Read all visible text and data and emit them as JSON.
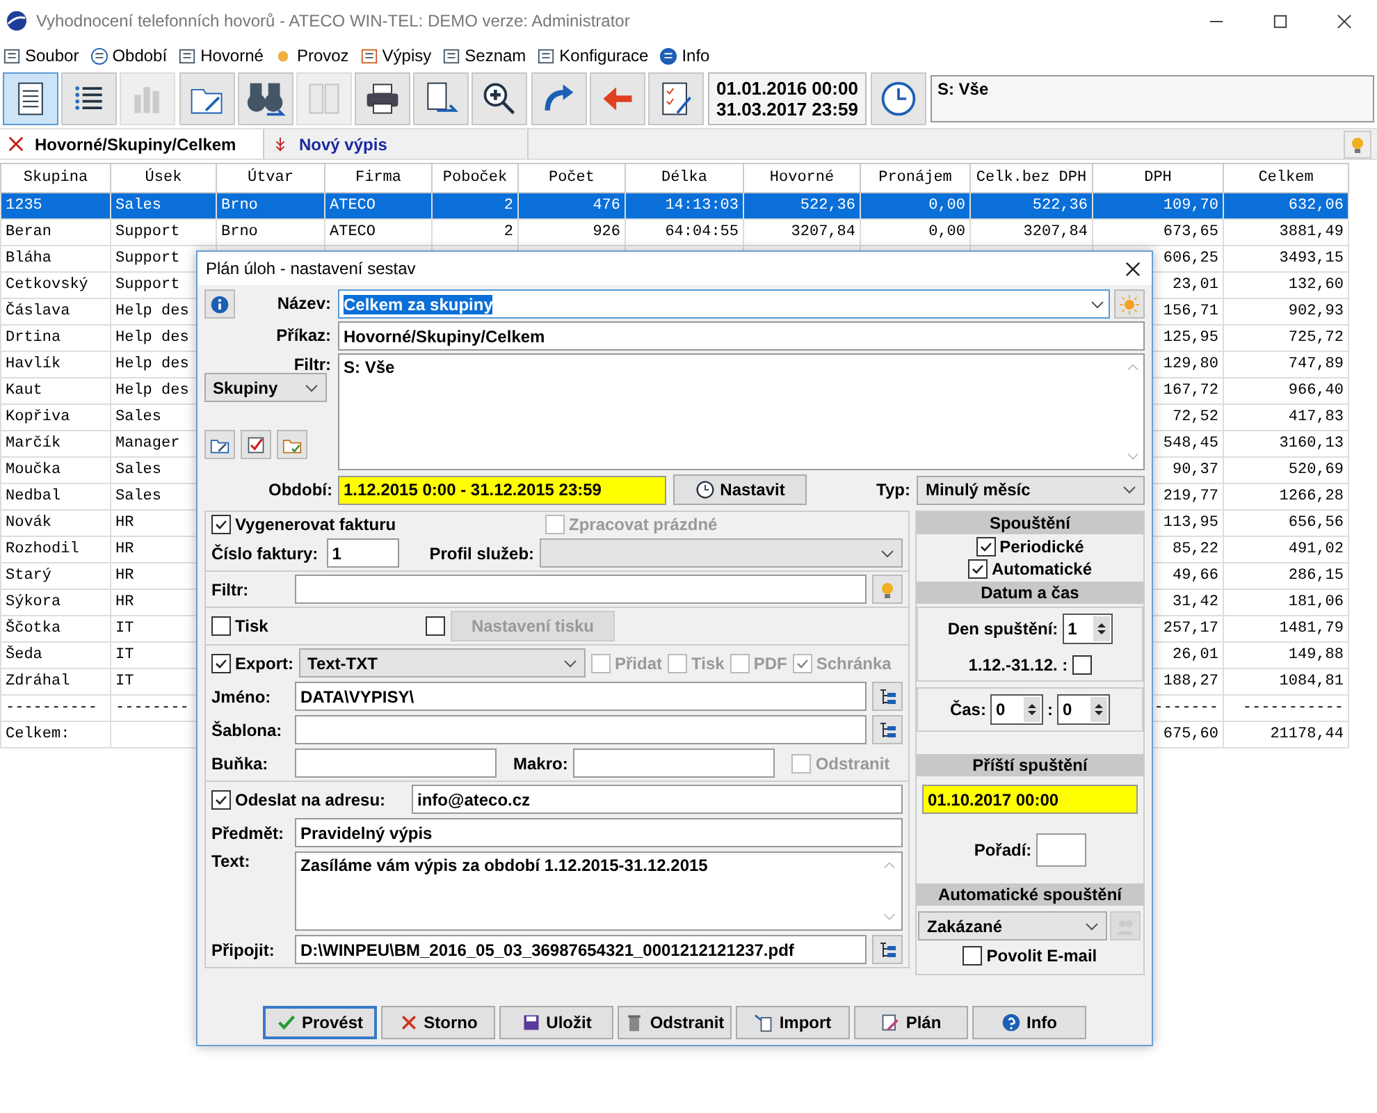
{
  "window": {
    "title": "Vyhodnocení telefonních hovorů - ATECO WIN-TEL: DEMO verze: Administrator"
  },
  "menu": [
    {
      "label": "Soubor"
    },
    {
      "label": "Období"
    },
    {
      "label": "Hovorné"
    },
    {
      "label": "Provoz"
    },
    {
      "label": "Výpisy"
    },
    {
      "label": "Seznam"
    },
    {
      "label": "Konfigurace"
    },
    {
      "label": "Info"
    }
  ],
  "toolbar": {
    "buttons": [
      {
        "selected": true,
        "disabled": false
      },
      {
        "selected": false,
        "disabled": false
      },
      {
        "selected": false,
        "disabled": true
      },
      {
        "selected": false,
        "disabled": false
      },
      {
        "selected": false,
        "disabled": false
      },
      {
        "selected": false,
        "disabled": true
      },
      {
        "selected": false,
        "disabled": false
      },
      {
        "selected": false,
        "disabled": false
      },
      {
        "selected": false,
        "disabled": false
      },
      {
        "selected": false,
        "disabled": false
      },
      {
        "selected": false,
        "disabled": false
      },
      {
        "selected": false,
        "disabled": false
      }
    ],
    "period_from": "01.01.2016 00:00",
    "period_to": "31.03.2017 23:59",
    "filter": "S: Vše"
  },
  "tabs": [
    {
      "label": "Hovorné/Skupiny/Celkem",
      "selected": true
    },
    {
      "label": "Nový výpis",
      "selected": false
    }
  ],
  "table": {
    "columns": [
      "Skupina",
      "Úsek",
      "Útvar",
      "Firma",
      "Poboček",
      "Počet",
      "Délka",
      "Hovorné",
      "Pronájem",
      "Celk.bez DPH",
      "DPH",
      "Celkem"
    ],
    "rows": [
      {
        "selected": true,
        "cells": [
          "1235",
          "Sales",
          "Brno",
          "ATECO",
          "2",
          "476",
          "14:13:03",
          "522,36",
          "0,00",
          "522,36",
          "109,70",
          "632,06"
        ]
      },
      {
        "selected": false,
        "cells": [
          "Beran",
          "Support",
          "Brno",
          "ATECO",
          "2",
          "926",
          "64:04:55",
          "3207,84",
          "0,00",
          "3207,84",
          "673,65",
          "3881,49"
        ]
      },
      {
        "selected": false,
        "cells": [
          "Bláha",
          "Support",
          null,
          null,
          null,
          null,
          null,
          null,
          null,
          null,
          "606,25",
          "3493,15"
        ]
      },
      {
        "selected": false,
        "cells": [
          "Cetkovský",
          "Support",
          null,
          null,
          null,
          null,
          null,
          null,
          null,
          null,
          "23,01",
          "132,60"
        ]
      },
      {
        "selected": false,
        "cells": [
          "Čáslava",
          "Help des",
          null,
          null,
          null,
          null,
          null,
          null,
          null,
          null,
          "156,71",
          "902,93"
        ]
      },
      {
        "selected": false,
        "cells": [
          "Drtina",
          "Help des",
          null,
          null,
          null,
          null,
          null,
          null,
          null,
          null,
          "125,95",
          "725,72"
        ]
      },
      {
        "selected": false,
        "cells": [
          "Havlík",
          "Help des",
          null,
          null,
          null,
          null,
          null,
          null,
          null,
          null,
          "129,80",
          "747,89"
        ]
      },
      {
        "selected": false,
        "cells": [
          "Kaut",
          "Help des",
          null,
          null,
          null,
          null,
          null,
          null,
          null,
          null,
          "167,72",
          "966,40"
        ]
      },
      {
        "selected": false,
        "cells": [
          "Kopřiva",
          "Sales",
          null,
          null,
          null,
          null,
          null,
          null,
          null,
          null,
          "72,52",
          "417,83"
        ]
      },
      {
        "selected": false,
        "cells": [
          "Marčík",
          "Manager",
          null,
          null,
          null,
          null,
          null,
          null,
          null,
          null,
          "548,45",
          "3160,13"
        ]
      },
      {
        "selected": false,
        "cells": [
          "Moučka",
          "Sales",
          null,
          null,
          null,
          null,
          null,
          null,
          null,
          null,
          "90,37",
          "520,69"
        ]
      },
      {
        "selected": false,
        "cells": [
          "Nedbal",
          "Sales",
          null,
          null,
          null,
          null,
          null,
          null,
          null,
          null,
          "219,77",
          "1266,28"
        ]
      },
      {
        "selected": false,
        "cells": [
          "Novák",
          "HR",
          null,
          null,
          null,
          null,
          null,
          null,
          null,
          null,
          "113,95",
          "656,56"
        ]
      },
      {
        "selected": false,
        "cells": [
          "Rozhodil",
          "HR",
          null,
          null,
          null,
          null,
          null,
          null,
          null,
          null,
          "85,22",
          "491,02"
        ]
      },
      {
        "selected": false,
        "cells": [
          "Starý",
          "HR",
          null,
          null,
          null,
          null,
          null,
          null,
          null,
          null,
          "49,66",
          "286,15"
        ]
      },
      {
        "selected": false,
        "cells": [
          "Sýkora",
          "HR",
          null,
          null,
          null,
          null,
          null,
          null,
          null,
          null,
          "31,42",
          "181,06"
        ]
      },
      {
        "selected": false,
        "cells": [
          "Ščotka",
          "IT",
          null,
          null,
          null,
          null,
          null,
          null,
          null,
          null,
          "257,17",
          "1481,79"
        ]
      },
      {
        "selected": false,
        "cells": [
          "Šeda",
          "IT",
          null,
          null,
          null,
          null,
          null,
          null,
          null,
          null,
          "26,01",
          "149,88"
        ]
      },
      {
        "selected": false,
        "cells": [
          "Zdráhal",
          "IT",
          null,
          null,
          null,
          null,
          null,
          null,
          null,
          null,
          "188,27",
          "1084,81"
        ]
      },
      {
        "selected": false,
        "cells": [
          "----------",
          "--------",
          null,
          null,
          null,
          null,
          null,
          null,
          null,
          null,
          "-------",
          "-----------"
        ]
      },
      {
        "selected": false,
        "cells": [
          "Celkem:",
          null,
          null,
          null,
          null,
          null,
          null,
          null,
          null,
          null,
          "675,60",
          "21178,44"
        ]
      }
    ]
  },
  "dialog": {
    "title": "Plán úloh - nastavení sestav",
    "name": {
      "label": "Název:",
      "value": "Celkem za skupiny"
    },
    "command": {
      "label": "Příkaz:",
      "value": "Hovorné/Skupiny/Celkem"
    },
    "filter": {
      "label": "Filtr:",
      "value": "S: Vše"
    },
    "group": "Skupiny",
    "period": {
      "label": "Období:",
      "value": "1.12.2015 0:00 - 31.12.2015 23:59"
    },
    "set_button": "Nastavit",
    "type": {
      "label": "Typ:",
      "value": "Minulý měsíc"
    },
    "invoice": {
      "generate": {
        "label": "Vygenerovat fakturu",
        "checked": true,
        "disabled": false
      },
      "process_empty": {
        "label": "Zpracovat prázdné",
        "checked": false,
        "disabled": true
      },
      "number_label": "Číslo faktury:",
      "number": "1",
      "profile_label": "Profil služeb:"
    },
    "filter2_label": "Filtr:",
    "print": {
      "checkbox": {
        "label": "Tisk",
        "checked": false
      },
      "second_checked": false,
      "settings_button": "Nastavení tisku",
      "settings_disabled": true
    },
    "export": {
      "checkbox": {
        "label": "Export:",
        "checked": true
      },
      "format": "Text-TXT",
      "options": [
        {
          "label": "Přidat",
          "checked": false,
          "disabled": true
        },
        {
          "label": "Tisk",
          "checked": false,
          "disabled": true
        },
        {
          "label": "PDF",
          "checked": false,
          "disabled": true
        },
        {
          "label": "Schránka",
          "checked": true,
          "disabled": true
        }
      ],
      "file": {
        "label": "Jméno:",
        "value": "DATA\\VYPISY\\"
      },
      "template_label": "Šablona:",
      "cell_label": "Buňka:",
      "macro_label": "Makro:",
      "remove": {
        "label": "Odstranit",
        "checked": false,
        "disabled": true
      }
    },
    "email": {
      "checkbox": {
        "label": "Odeslat na adresu:",
        "checked": true
      },
      "address": "info@ateco.cz",
      "subject": {
        "label": "Předmět:",
        "value": "Pravidelný výpis"
      },
      "text": {
        "label": "Text:",
        "value": "Zasíláme vám výpis za období 1.12.2015-31.12.2015"
      },
      "attach": {
        "label": "Připojit:",
        "value": "D:\\WINPEU\\BM_2016_05_03_36987654321_0001212121237.pdf"
      }
    },
    "schedule": {
      "run_header": "Spouštění",
      "run_options": [
        {
          "label": "Periodické",
          "checked": true
        },
        {
          "label": "Automatické",
          "checked": true
        }
      ],
      "datetime_header": "Datum a čas",
      "day_label": "Den spuštění:",
      "day": "1",
      "range_label": "1.12.-31.12. :",
      "range_checked": false,
      "time_label": "Čas:",
      "hour": "0",
      "time_sep": ":",
      "minute": "0",
      "next_header": "Příští spuštění",
      "next": "01.10.2017 00:00",
      "order_label": "Pořadí:",
      "auto_header": "Automatické spouštění",
      "auto_value": "Zakázané",
      "allow_email": {
        "label": "Povolit E-mail",
        "checked": false
      }
    },
    "buttons": [
      {
        "label": "Provést",
        "default": true
      },
      {
        "label": "Storno",
        "default": false
      },
      {
        "label": "Uložit",
        "default": false
      },
      {
        "label": "Odstranit",
        "default": false
      },
      {
        "label": "Import",
        "default": false
      },
      {
        "label": "Plán",
        "default": false
      },
      {
        "label": "Info",
        "default": false
      }
    ]
  }
}
